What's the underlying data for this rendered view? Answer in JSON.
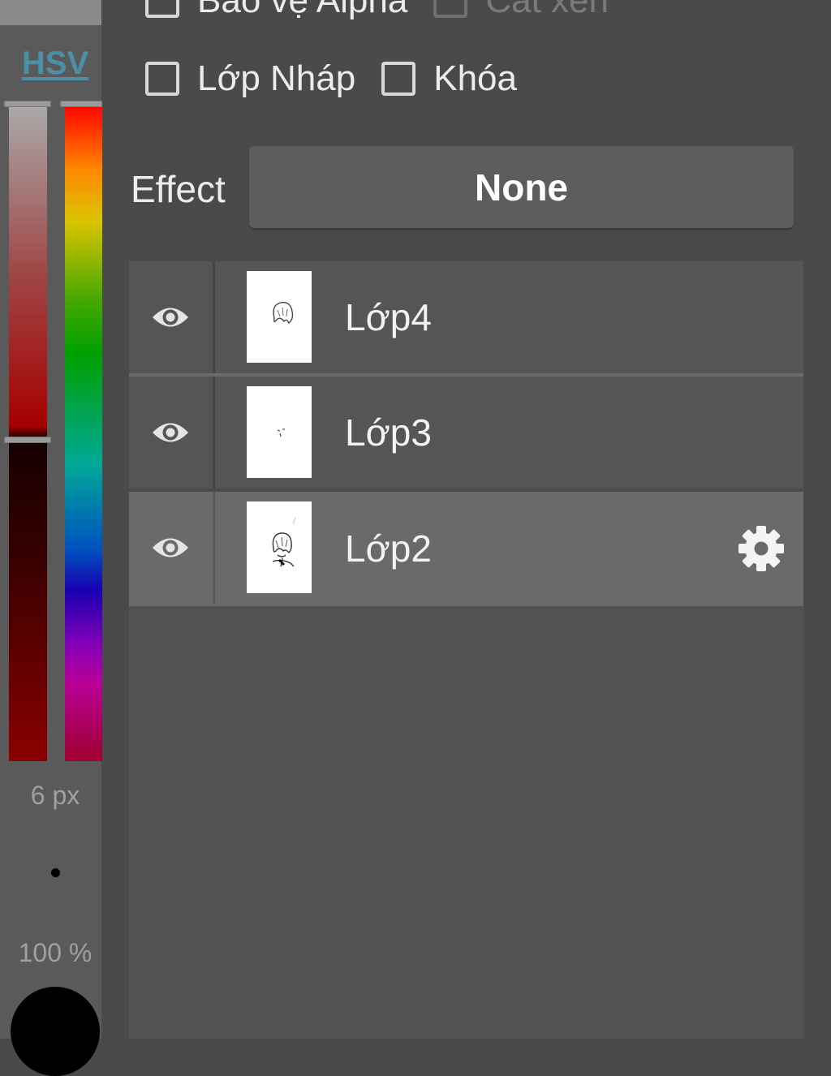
{
  "sidebar": {
    "color_mode_tab": "HSV",
    "brush_size": "6 px",
    "opacity": "100 %",
    "current_color": "#000000"
  },
  "options": {
    "alpha_protect": "Bảo vệ Alpha",
    "clipping": "Cắt xén",
    "draft_layer": "Lớp Nháp",
    "lock": "Khóa"
  },
  "effect": {
    "label": "Effect",
    "value": "None"
  },
  "layers": [
    {
      "name": "Lớp4",
      "visible": true,
      "selected": false
    },
    {
      "name": "Lớp3",
      "visible": true,
      "selected": false
    },
    {
      "name": "Lớp2",
      "visible": true,
      "selected": true
    }
  ],
  "icons": {
    "visibility": "eye-icon",
    "layer_settings": "gear-icon"
  }
}
